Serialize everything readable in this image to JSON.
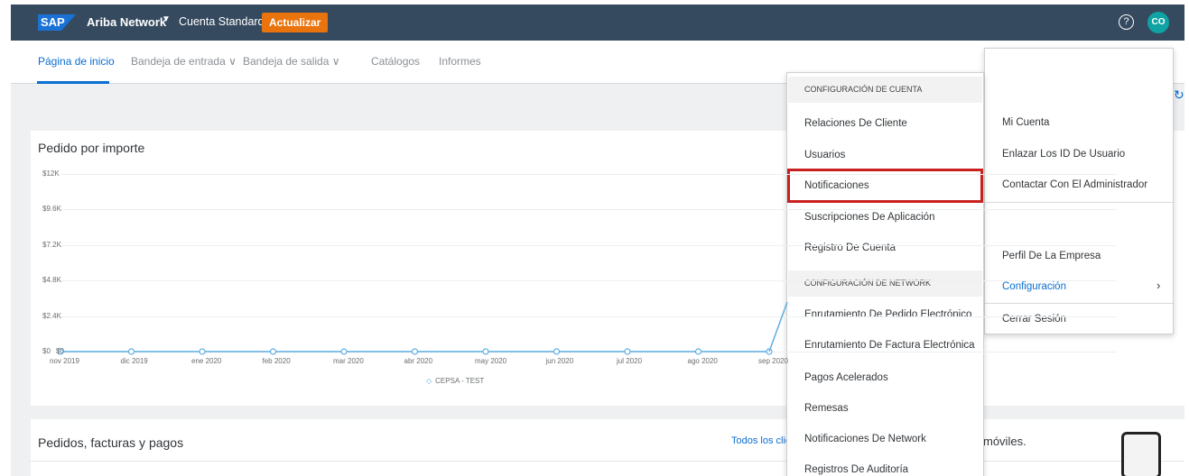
{
  "header": {
    "logo": "SAP",
    "app_name": "Ariba Network",
    "account_label": "Cuenta Standard",
    "upgrade_button": "Actualizar",
    "help_icon": "question-circle-icon",
    "avatar_initials": "CO"
  },
  "tabs": [
    {
      "label": "Página de inicio",
      "active": true
    },
    {
      "label": "Bandeja de entrada ∨",
      "active": false
    },
    {
      "label": "Bandeja de salida ∨",
      "active": false
    },
    {
      "label": "Catálogos",
      "active": false
    },
    {
      "label": "Informes",
      "active": false
    }
  ],
  "chart_card": {
    "title": "Pedido por importe"
  },
  "chart_data": {
    "type": "line",
    "categories": [
      "nov 2019",
      "dic 2019",
      "ene 2020",
      "feb 2020",
      "mar 2020",
      "abr 2020",
      "may 2020",
      "jun 2020",
      "jul 2020",
      "ago 2020",
      "sep 2020"
    ],
    "y_ticks": [
      "$12K",
      "$9.6K",
      "$7.2K",
      "$4.8K",
      "$2.4K",
      "$0"
    ],
    "ylim": [
      0,
      12000
    ],
    "series": [
      {
        "name": "CEPSA - TEST",
        "values": [
          0,
          0,
          0,
          0,
          0,
          0,
          0,
          0,
          0,
          0,
          0
        ],
        "color": "#5dade2"
      }
    ],
    "grid": true,
    "legend_position": "bottom"
  },
  "orders_card": {
    "title": "Pedidos, facturas y pagos",
    "link": "Todos los clie",
    "mobile_text": "móviles."
  },
  "menu_left": {
    "group_account": "CONFIGURACIÓN DE CUENTA",
    "account_items": [
      "Relaciones De Cliente",
      "Usuarios",
      "Notificaciones",
      "Suscripciones De Aplicación",
      "Registro De Cuenta"
    ],
    "group_network": "CONFIGURACIÓN DE NETWORK",
    "network_items": [
      "Enrutamiento De Pedido Electrónico",
      "Enrutamiento De Factura Electrónica",
      "Pagos Acelerados",
      "Remesas",
      "Notificaciones De Network",
      "Registros De Auditoría"
    ],
    "highlighted_item": "Notificaciones"
  },
  "menu_right": {
    "items_top": [
      "Mi Cuenta",
      "Enlazar Los ID De Usuario",
      "Contactar Con El Administrador"
    ],
    "items_mid": [
      "Perfil De La Empresa",
      "Configuración"
    ],
    "items_bottom": [
      "Cerrar Sesión"
    ],
    "selected": "Configuración"
  },
  "colors": {
    "topbar": "#354a5f",
    "accent": "#0a6ed1",
    "upgrade": "#e9730c",
    "highlight_border": "#c8201e"
  }
}
